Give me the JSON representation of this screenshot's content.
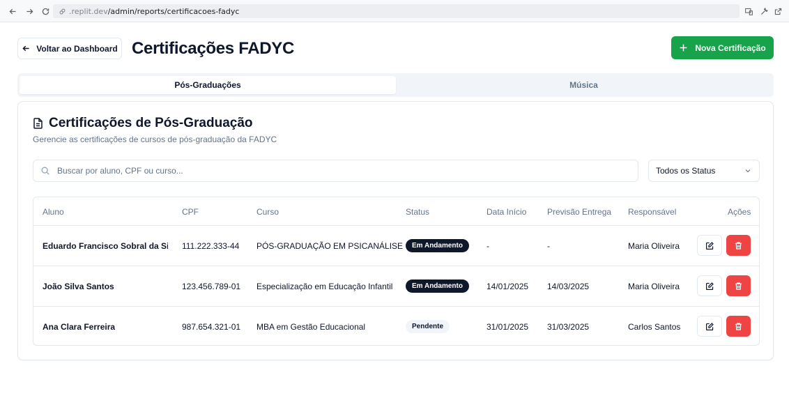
{
  "browser": {
    "url_domain": ".replit.dev",
    "url_path": "/admin/reports/certificacoes-fadyc"
  },
  "header": {
    "back_label": "Voltar ao Dashboard",
    "title": "Certificações FADYC",
    "new_label": "Nova Certificação"
  },
  "tabs": [
    {
      "label": "Pós-Graduações",
      "active": true
    },
    {
      "label": "Música",
      "active": false
    }
  ],
  "card": {
    "title": "Certificações de Pós-Graduação",
    "subtitle": "Gerencie as certificações de cursos de pós-graduação da FADYC"
  },
  "filters": {
    "search_placeholder": "Buscar por aluno, CPF ou curso...",
    "status_value": "Todos os Status"
  },
  "table": {
    "columns": [
      "Aluno",
      "CPF",
      "Curso",
      "Status",
      "Data Início",
      "Previsão Entrega",
      "Responsável",
      "Ações"
    ],
    "rows": [
      {
        "aluno": "Eduardo Francisco Sobral da Silv",
        "cpf": "111.222.333-44",
        "curso": "PÓS-GRADUAÇÃO EM PSICANÁLISE",
        "status": "Em Andamento",
        "status_style": "dark",
        "inicio": "-",
        "previsao": "-",
        "responsavel": "Maria Oliveira"
      },
      {
        "aluno": "João Silva Santos",
        "cpf": "123.456.789-01",
        "curso": "Especialização em Educação Infantil",
        "status": "Em Andamento",
        "status_style": "dark",
        "inicio": "14/01/2025",
        "previsao": "14/03/2025",
        "responsavel": "Maria Oliveira"
      },
      {
        "aluno": "Ana Clara Ferreira",
        "cpf": "987.654.321-01",
        "curso": "MBA em Gestão Educacional",
        "status": "Pendente",
        "status_style": "light",
        "inicio": "31/01/2025",
        "previsao": "31/03/2025",
        "responsavel": "Carlos Santos"
      }
    ]
  },
  "colors": {
    "primary_green": "#16a34a",
    "danger_red": "#ef4444",
    "badge_dark": "#0f172a"
  }
}
